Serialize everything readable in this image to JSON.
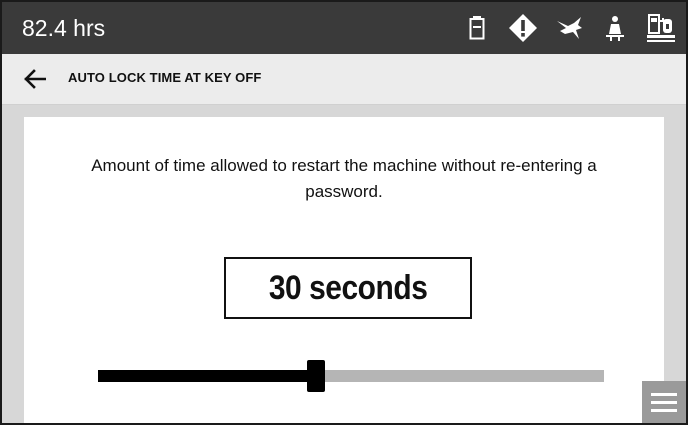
{
  "status_bar": {
    "hours": "82.4 hrs",
    "icons": [
      "aux-battery-icon",
      "warning-icon",
      "rabbit-speed-icon",
      "seat-operator-icon",
      "fuel-pump-icon"
    ]
  },
  "header": {
    "back_icon": "arrow-left-icon",
    "title": "AUTO LOCK TIME AT KEY OFF"
  },
  "main": {
    "description": "Amount of time allowed to restart the machine without re-entering a password.",
    "value": "30 seconds",
    "slider_fraction": 0.43
  },
  "menu_icon": "hamburger-menu-icon",
  "colors": {
    "status_bar_bg": "#3a3a3a",
    "title_bar_bg": "#ececec",
    "content_bg": "#d7d7d7",
    "slider_fill": "#000000",
    "slider_track": "#b5b5b5",
    "menu_button_bg": "#9a9a9a"
  }
}
